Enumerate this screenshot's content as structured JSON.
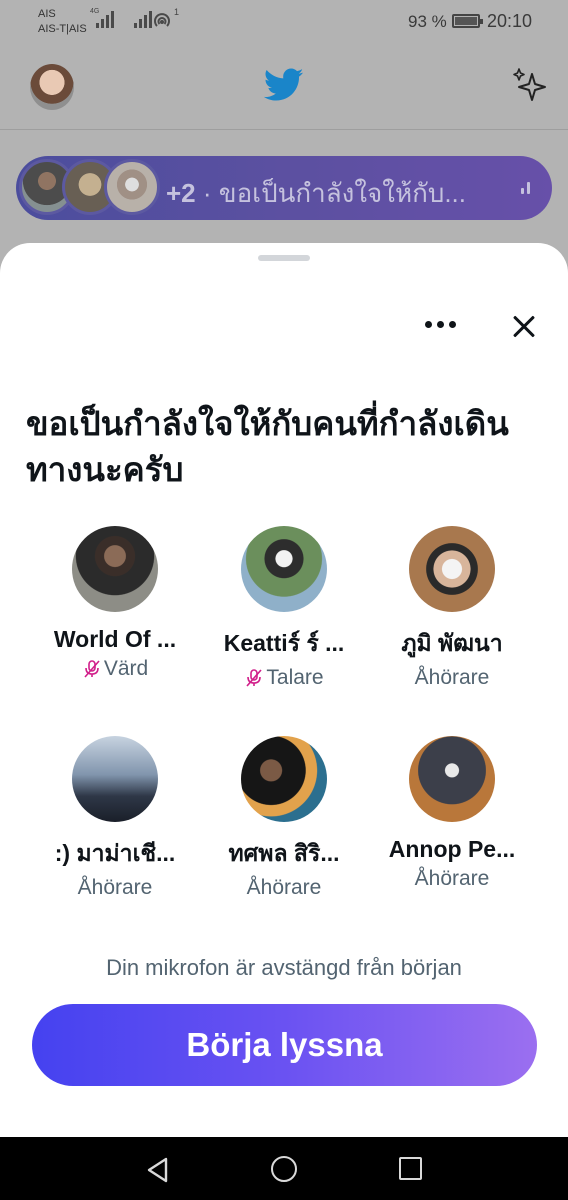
{
  "status_bar": {
    "carrier_1": "AIS",
    "carrier_2": "AIS-T|AIS",
    "network": "4G",
    "wifi_badge": "1",
    "battery": "93 %",
    "time": "20:10"
  },
  "header": {
    "logo_icon": "twitter-bird-icon",
    "sparkle_icon": "sparkle-icon"
  },
  "live_space_bar": {
    "extra_count": "+2",
    "separator": "·",
    "title": "ขอเป็นกำลังใจให้กับ..."
  },
  "sheet": {
    "title": "ขอเป็นกำลังใจให้กับคนที่กำลังเดินทางนะครับ",
    "participants": [
      {
        "name": "World Of ...",
        "role": "Värd",
        "muted": true
      },
      {
        "name": "Keattiร์ ร์ ...",
        "role": "Talare",
        "muted": true
      },
      {
        "name": "ภูมิ  พัฒนา",
        "role": "Åhörare",
        "muted": false
      },
      {
        "name": ":) มาม่าเชี...",
        "role": "Åhörare",
        "muted": false
      },
      {
        "name": "ทศพล สิริ...",
        "role": "Åhörare",
        "muted": false
      },
      {
        "name": "Annop Pe...",
        "role": "Åhörare",
        "muted": false
      }
    ],
    "mic_note": "Din mikrofon är avstängd från början",
    "listen_button": "Börja lyssna"
  },
  "colors": {
    "accent_start": "#4542f0",
    "accent_end": "#9b6ff0",
    "muted_mic": "#d11f8a",
    "twitter_blue": "#1d9bf0"
  }
}
